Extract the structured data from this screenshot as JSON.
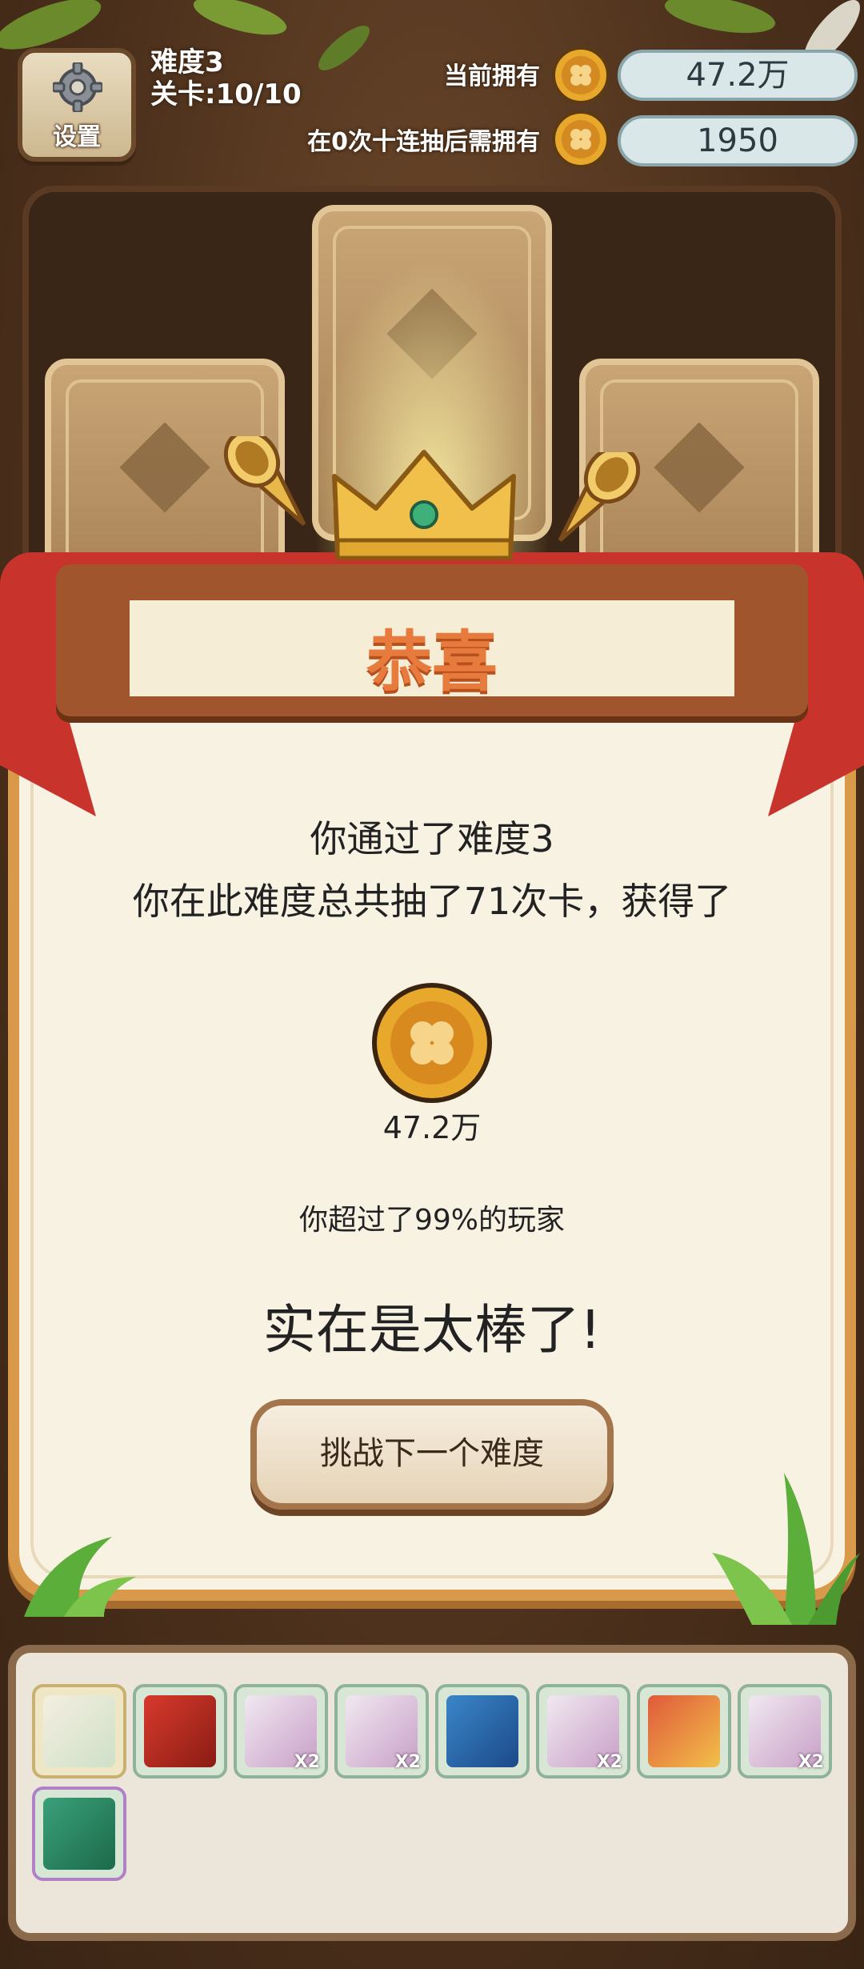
{
  "hud": {
    "settings_label": "设置",
    "difficulty": "难度3",
    "stage": "关卡:10/10",
    "owned_label": "当前拥有",
    "owned_value": "47.2万",
    "required_label": "在0次十连抽后需拥有",
    "required_value": "1950"
  },
  "dialog": {
    "title": "恭喜",
    "line1": "你通过了难度3",
    "line2": "你在此难度总共抽了71次卡，获得了",
    "reward_value": "47.2万",
    "percentile": "你超过了99%的玩家",
    "praise": "实在是太棒了!",
    "cta_label": "挑战下一个难度"
  },
  "inventory": {
    "items": [
      {
        "icon": "card-swap-icon",
        "badge": ""
      },
      {
        "icon": "red-pack-icon",
        "badge": ""
      },
      {
        "icon": "card-pair-icon",
        "badge": "X2"
      },
      {
        "icon": "card-pair-icon",
        "badge": "X2"
      },
      {
        "icon": "blue-pack-icon",
        "badge": ""
      },
      {
        "icon": "card-pair-icon",
        "badge": "X2"
      },
      {
        "icon": "chest-icon",
        "badge": ""
      },
      {
        "icon": "card-pair-icon",
        "badge": "X2"
      },
      {
        "icon": "green-pack-icon",
        "badge": ""
      }
    ]
  },
  "colors": {
    "coin": "#e8a82c",
    "title": "#e77b3d",
    "ribbon": "#c8332b",
    "frame": "#d89a4a"
  }
}
